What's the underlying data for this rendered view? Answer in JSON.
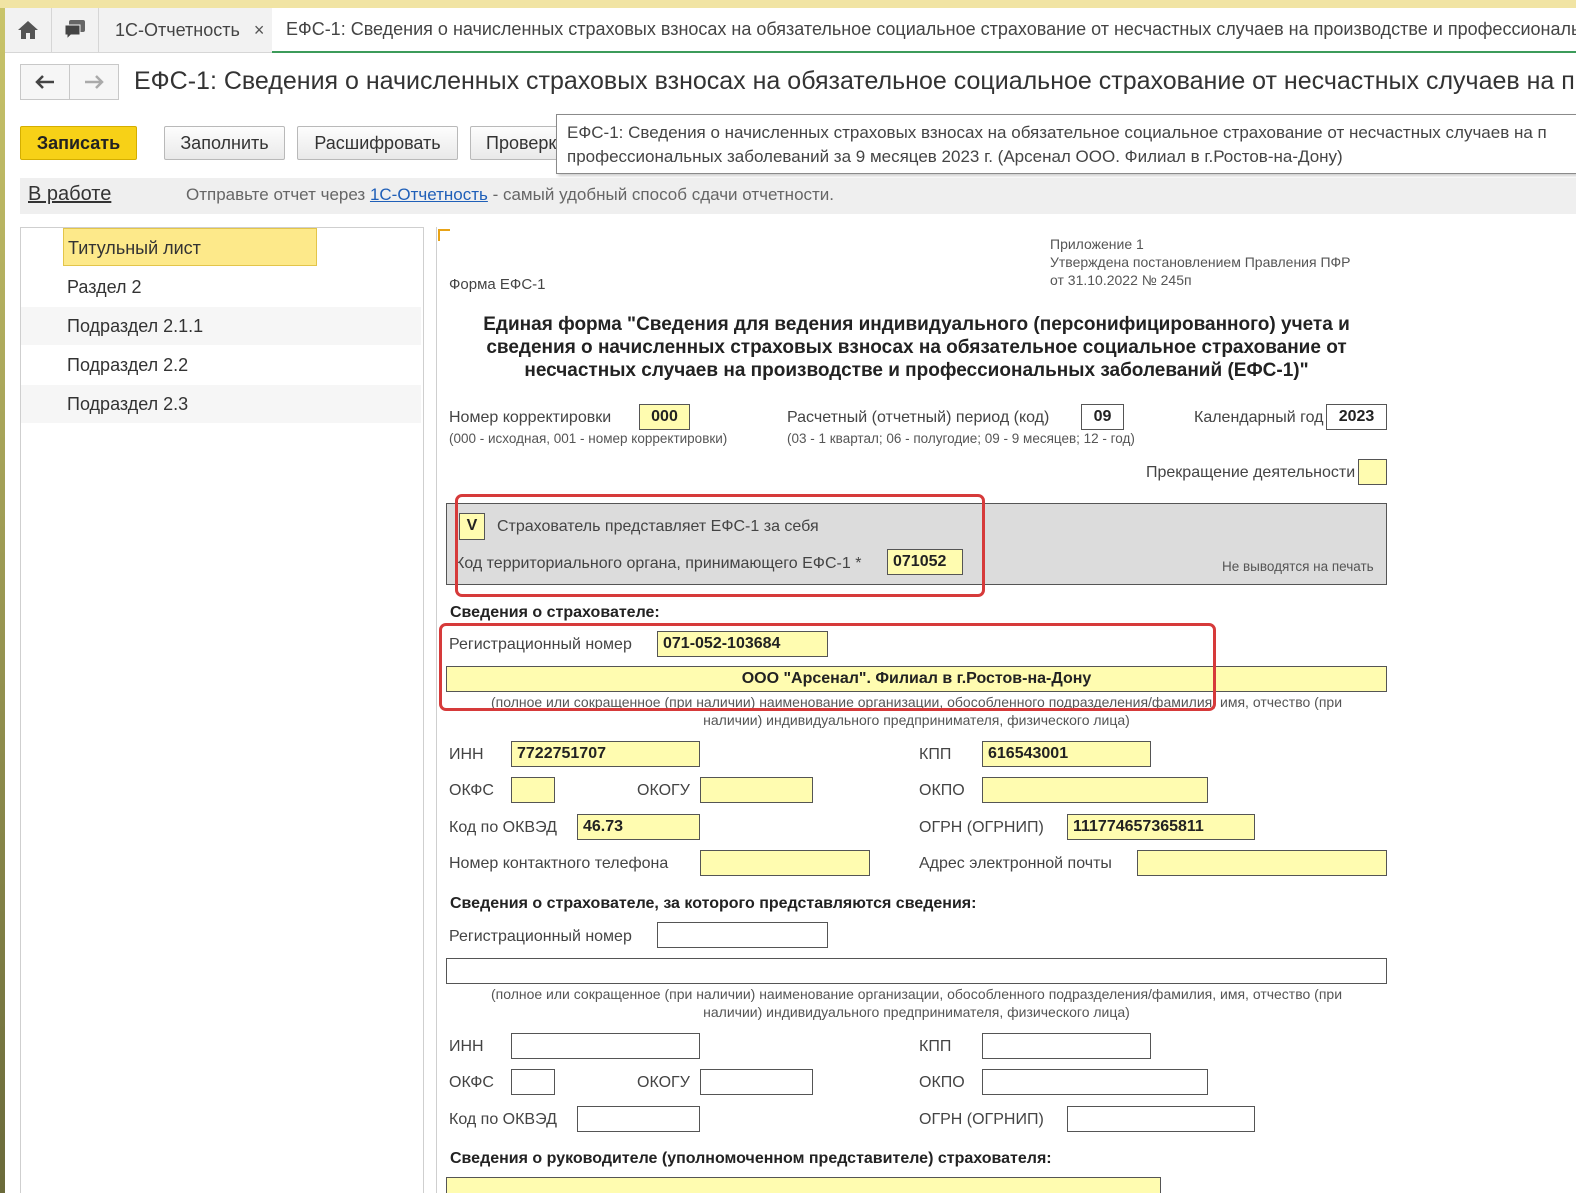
{
  "tabs": {
    "home_icon": "home-icon",
    "chat_icon": "chat-icon",
    "tab1_label": "1С-Отчетность",
    "tab1_close": "×",
    "tab2_label": "ЕФС-1: Сведения о начисленных страховых взносах на обязательное социальное страхование от несчастных случаев на производстве и профессиональ"
  },
  "header": {
    "back_icon": "arrow-left-icon",
    "forward_icon": "arrow-right-icon",
    "title": "ЕФС-1: Сведения о начисленных страховых взносах на обязательное социальное страхование от несчастных случаев на п"
  },
  "toolbar": {
    "save": "Записать",
    "fill": "Заполнить",
    "decode": "Расшифровать",
    "check": "Проверк"
  },
  "tooltip": {
    "line1": "ЕФС-1: Сведения о начисленных страховых взносах на обязательное социальное страхование от несчастных случаев на п",
    "line2": "профессиональных заболеваний за 9 месяцев 2023 г. (Арсенал ООО. Филиал в г.Ростов-на-Дону)"
  },
  "infobar": {
    "status": "В работе",
    "text_before": "Отправьте отчет через ",
    "link": "1С-Отчетность",
    "text_after": " - самый удобный способ сдачи отчетности."
  },
  "nav": {
    "items": [
      "Титульный лист",
      "Раздел 2",
      "Подраздел 2.1.1",
      "Подраздел 2.2",
      "Подраздел 2.3"
    ]
  },
  "form": {
    "appendix_line1": "Приложение 1",
    "appendix_line2": "Утверждена постановлением Правления ПФР",
    "appendix_line3": "от 31.10.2022 № 245п",
    "form_name": "Форма ЕФС-1",
    "title_line1": "Единая форма \"Сведения для ведения индивидуального (персонифицированного) учета и",
    "title_line2": "сведения о начисленных страховых взносах на обязательное социальное страхование от",
    "title_line3": "несчастных случаев на производстве и профессиональных заболеваний (ЕФС-1)\"",
    "correction_label": "Номер корректировки",
    "correction_value": "000",
    "correction_hint": "(000 - исходная, 001 - номер корректировки)",
    "period_label": "Расчетный (отчетный) период (код)",
    "period_value": "09",
    "period_hint": "(03 - 1 квартал; 06 - полугодие; 09 - 9 месяцев; 12 - год)",
    "year_label": "Календарный год",
    "year_value": "2023",
    "termination_label": "Прекращение деятельности",
    "self_check": "V",
    "self_label": "Страхователь представляет ЕФС-1 за себя",
    "territorial_label": "Код территориального органа, принимающего ЕФС-1 *",
    "territorial_value": "071052",
    "no_print": "Не выводятся на печать",
    "insurer_heading": "Сведения о страхователе:",
    "reg_label": "Регистрационный номер",
    "reg_value": "071-052-103684",
    "org_name": "ООО \"Арсенал\". Филиал в г.Ростов-на-Дону",
    "name_caption_line1": "(полное или сокращенное (при наличии) наименование организации, обособленного подразделения/фамилия, имя, отчество (при",
    "name_caption_line2": "наличии) индивидуального предпринимателя, физического лица)",
    "inn_label": "ИНН",
    "inn_value": "7722751707",
    "kpp_label": "КПП",
    "kpp_value": "616543001",
    "okfs_label": "ОКФС",
    "okfs_value": "",
    "okogu_label": "ОКОГУ",
    "okogu_value": "",
    "okpo_label": "ОКПО",
    "okpo_value": "",
    "okved_label": "Код по ОКВЭД",
    "okved_value": "46.73",
    "ogrn_label": "ОГРН (ОГРНИП)",
    "ogrn_value": "111774657365811",
    "phone_label": "Номер контактного телефона",
    "phone_value": "",
    "email_label": "Адрес электронной почты",
    "email_value": "",
    "for_whom_heading": "Сведения о страхователе, за которого представляются сведения:",
    "reg2_label": "Регистрационный номер",
    "inn2_label": "ИНН",
    "kpp2_label": "КПП",
    "okfs2_label": "ОКФС",
    "okogu2_label": "ОКОГУ",
    "okpo2_label": "ОКПО",
    "okved2_label": "Код по ОКВЭД",
    "ogrn2_label": "ОГРН (ОГРНИП)",
    "head_heading": "Сведения о руководителе (уполномоченном представителе) страхователя:"
  }
}
